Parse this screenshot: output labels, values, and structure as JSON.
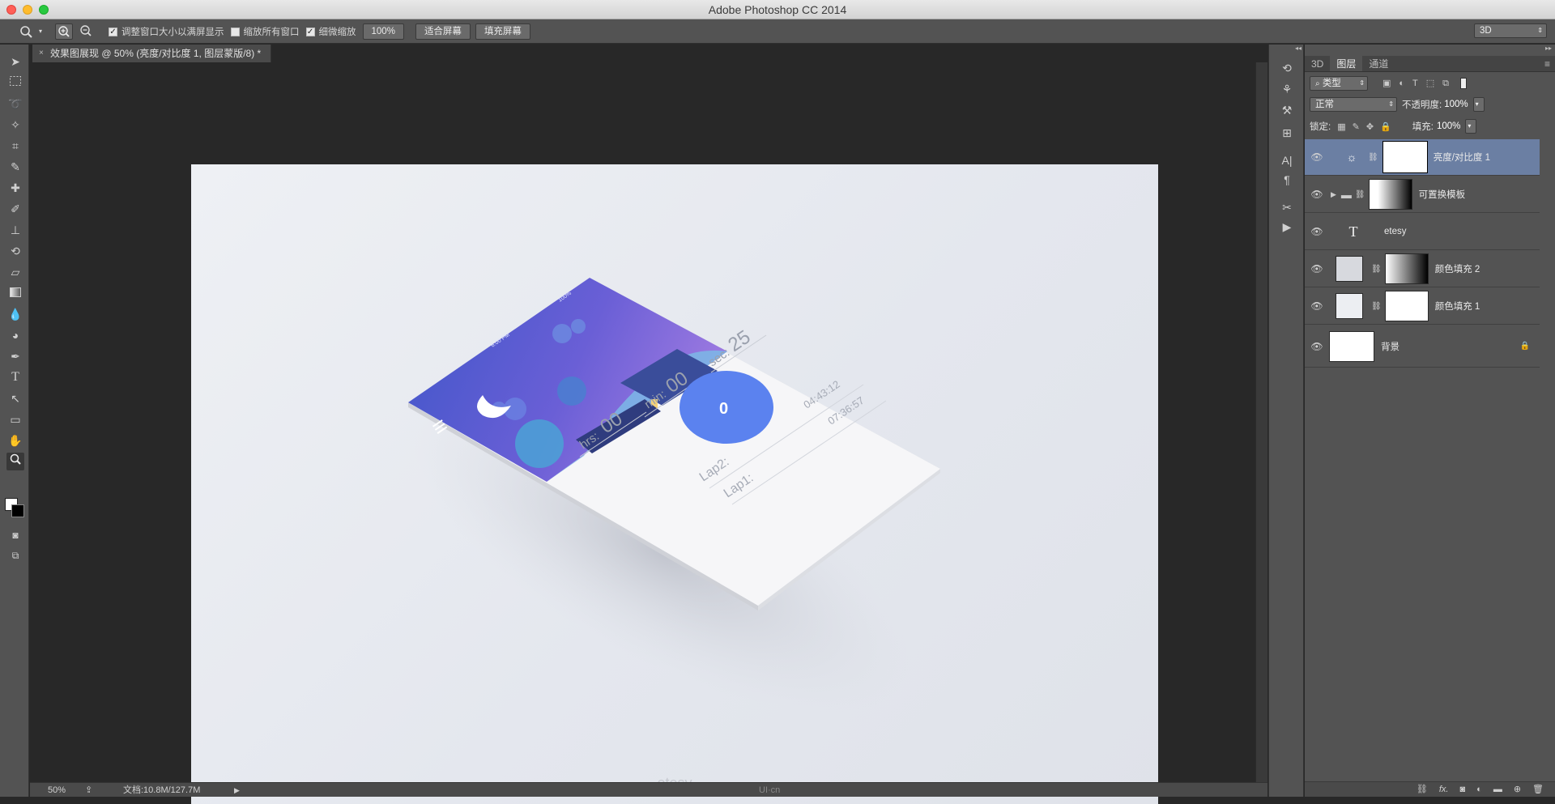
{
  "window": {
    "title": "Adobe Photoshop CC 2014"
  },
  "options_bar": {
    "cb1_label": "调整窗口大小以满屏显示",
    "cb2_label": "缩放所有窗口",
    "cb3_label": "细微缩放",
    "zoom_value": "100%",
    "fit_button": "适合屏幕",
    "fill_button": "填充屏幕",
    "workspace": "3D"
  },
  "document_tab": {
    "label": "效果图展现 @ 50% (亮度/对比度 1, 图层蒙版/8) *"
  },
  "canvas": {
    "watermark": "etesy",
    "phone": {
      "status_time": "6:00 PM",
      "status_battery": "100%",
      "hrs_label": "hrs:",
      "hrs_value": "00",
      "min_label": "min:",
      "min_value": "00",
      "sec_label": "sec:",
      "sec_value": "25",
      "button_value": "0",
      "lap2_label": "Lap2:",
      "lap2_value": "04:43:12",
      "lap1_label": "Lap1:",
      "lap1_value": "07:36:57"
    }
  },
  "status_bar": {
    "zoom": "50%",
    "doc_info": "文档:10.8M/127.7M",
    "center_logo": "UI·cn"
  },
  "layers_panel": {
    "tabs": [
      "3D",
      "图层",
      "通道"
    ],
    "filter_kind": "类型",
    "blend_mode": "正常",
    "opacity_label": "不透明度:",
    "opacity_value": "100%",
    "lock_label": "锁定:",
    "fill_label": "填充:",
    "fill_value": "100%",
    "layers": [
      {
        "name": "亮度/对比度 1"
      },
      {
        "name": "可置换模板"
      },
      {
        "name": "etesy"
      },
      {
        "name": "颜色填充 2"
      },
      {
        "name": "颜色填充 1"
      },
      {
        "name": "背景"
      }
    ]
  },
  "colors": {
    "selected_layer": "#6b7fa3",
    "phone_button": "#5b82ef"
  }
}
